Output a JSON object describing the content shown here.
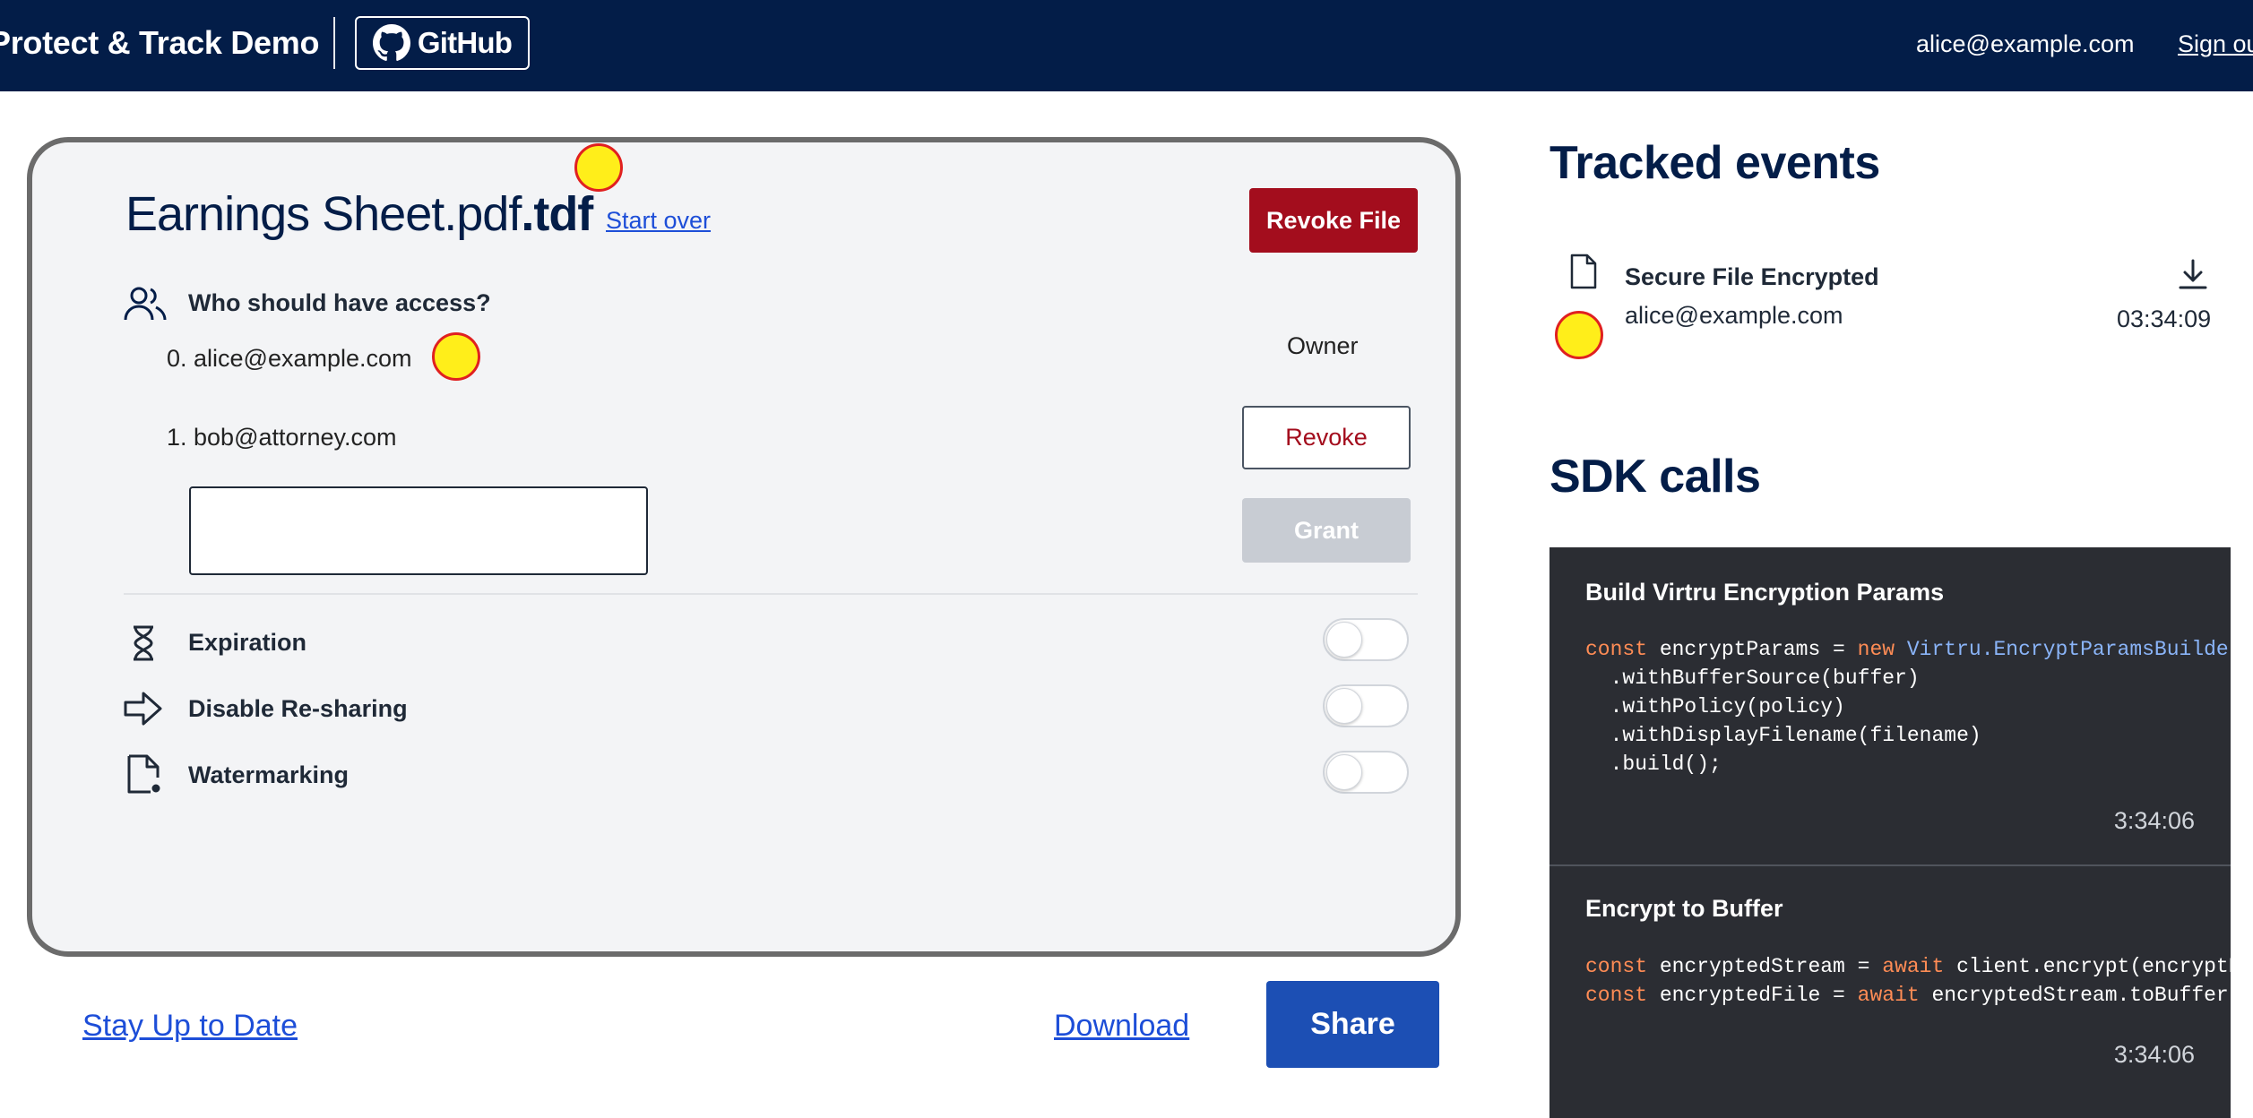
{
  "header": {
    "brand": "Protect & Track Demo",
    "github_label": "GitHub",
    "user_email": "alice@example.com",
    "signout_label": "Sign out"
  },
  "file": {
    "name": "Earnings Sheet.pdf",
    "ext": ".tdf",
    "start_over": "Start over",
    "revoke_file": "Revoke File"
  },
  "access": {
    "heading": "Who should have access?",
    "users": [
      {
        "label": "0. alice@example.com",
        "role": "Owner"
      },
      {
        "label": "1. bob@attorney.com",
        "action": "Revoke"
      }
    ],
    "input_value": "",
    "input_placeholder": "",
    "grant_label": "Grant"
  },
  "options": [
    {
      "label": "Expiration",
      "icon": "hourglass-icon",
      "enabled": false
    },
    {
      "label": "Disable Re-sharing",
      "icon": "arrow-right-icon",
      "enabled": false
    },
    {
      "label": "Watermarking",
      "icon": "watermark-doc-icon",
      "enabled": false
    }
  ],
  "bottom": {
    "stay_up_to_date": "Stay Up to Date",
    "download": "Download",
    "share": "Share"
  },
  "tracked": {
    "title": "Tracked events",
    "events": [
      {
        "title": "Secure File Encrypted",
        "user": "alice@example.com",
        "time": "03:34:09"
      }
    ]
  },
  "sdk": {
    "title": "SDK calls",
    "calls": [
      {
        "title": "Build Virtru Encryption Params",
        "code_lines": [
          {
            "kw": "const",
            "text": " encryptParams = ",
            "kw2": "new",
            "cls": " Virtru.EncryptParamsBuilder()"
          },
          {
            "text": "  .withBufferSource(buffer)"
          },
          {
            "text": "  .withPolicy(policy)"
          },
          {
            "text": "  .withDisplayFilename(filename)"
          },
          {
            "text": "  .build();"
          }
        ],
        "time": "3:34:06"
      },
      {
        "title": "Encrypt to Buffer",
        "code_lines": [
          {
            "kw": "const",
            "text": " encryptedStream = ",
            "kw2": "await",
            "rest": " client.encrypt(encryptParams);"
          },
          {
            "kw": "const",
            "text": " encryptedFile = ",
            "kw2": "await",
            "rest": " encryptedStream.toBuffer();"
          }
        ],
        "time": "3:34:06"
      }
    ]
  },
  "colors": {
    "header_bg": "#031d48",
    "revoke_red": "#a30d1d",
    "share_blue": "#1c4fb4",
    "link_blue": "#1d4ed8",
    "code_bg": "#2b2d33",
    "code_keyword": "#ff8c55",
    "code_class": "#8ab4f8"
  }
}
